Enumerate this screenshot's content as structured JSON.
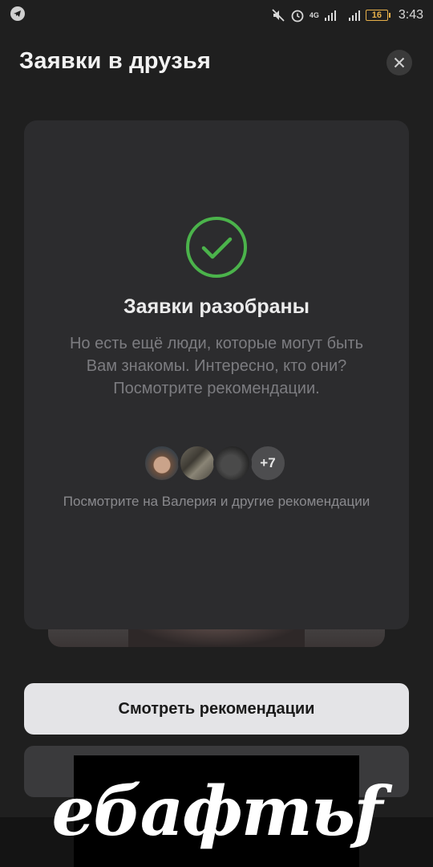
{
  "status_bar": {
    "time": "3:43",
    "network_label": "4G",
    "battery_level": "16",
    "icons": [
      "telegram-icon",
      "mute-icon",
      "alarm-icon",
      "signal-icon",
      "signal-icon",
      "battery-icon"
    ]
  },
  "header": {
    "title": "Заявки в друзья",
    "close_icon": "close-icon"
  },
  "card": {
    "icon": "check-circle-icon",
    "title": "Заявки разобраны",
    "text": "Но есть ещё люди, которые могут быть Вам знакомы. Интересно, кто они? Посмотрите рекомендации.",
    "more_count": "+7",
    "caption": "Посмотрите на Валерия и другие рекомендации"
  },
  "actions": {
    "primary_label": "Смотреть рекомендации"
  },
  "watermark": {
    "text": "ебафтьf"
  },
  "colors": {
    "background": "#1f1f1f",
    "card": "#2c2c2e",
    "accent_green": "#4bb34b",
    "primary_button": "#e4e4e7"
  }
}
